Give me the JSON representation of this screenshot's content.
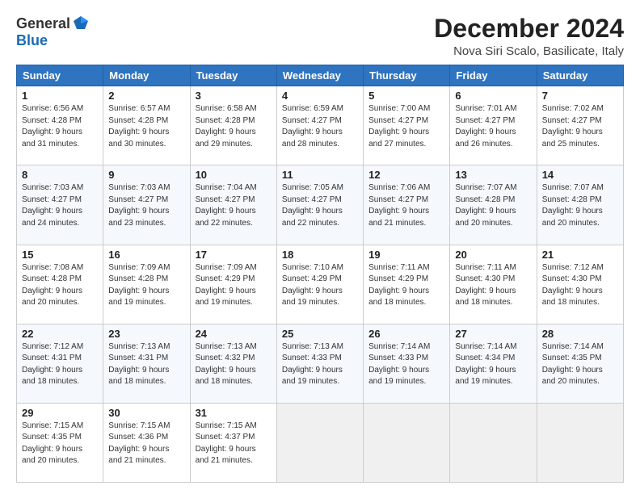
{
  "header": {
    "logo_general": "General",
    "logo_blue": "Blue",
    "month_title": "December 2024",
    "location": "Nova Siri Scalo, Basilicate, Italy"
  },
  "days_of_week": [
    "Sunday",
    "Monday",
    "Tuesday",
    "Wednesday",
    "Thursday",
    "Friday",
    "Saturday"
  ],
  "weeks": [
    [
      {
        "day": "1",
        "info": "Sunrise: 6:56 AM\nSunset: 4:28 PM\nDaylight: 9 hours\nand 31 minutes."
      },
      {
        "day": "2",
        "info": "Sunrise: 6:57 AM\nSunset: 4:28 PM\nDaylight: 9 hours\nand 30 minutes."
      },
      {
        "day": "3",
        "info": "Sunrise: 6:58 AM\nSunset: 4:28 PM\nDaylight: 9 hours\nand 29 minutes."
      },
      {
        "day": "4",
        "info": "Sunrise: 6:59 AM\nSunset: 4:27 PM\nDaylight: 9 hours\nand 28 minutes."
      },
      {
        "day": "5",
        "info": "Sunrise: 7:00 AM\nSunset: 4:27 PM\nDaylight: 9 hours\nand 27 minutes."
      },
      {
        "day": "6",
        "info": "Sunrise: 7:01 AM\nSunset: 4:27 PM\nDaylight: 9 hours\nand 26 minutes."
      },
      {
        "day": "7",
        "info": "Sunrise: 7:02 AM\nSunset: 4:27 PM\nDaylight: 9 hours\nand 25 minutes."
      }
    ],
    [
      {
        "day": "8",
        "info": "Sunrise: 7:03 AM\nSunset: 4:27 PM\nDaylight: 9 hours\nand 24 minutes."
      },
      {
        "day": "9",
        "info": "Sunrise: 7:03 AM\nSunset: 4:27 PM\nDaylight: 9 hours\nand 23 minutes."
      },
      {
        "day": "10",
        "info": "Sunrise: 7:04 AM\nSunset: 4:27 PM\nDaylight: 9 hours\nand 22 minutes."
      },
      {
        "day": "11",
        "info": "Sunrise: 7:05 AM\nSunset: 4:27 PM\nDaylight: 9 hours\nand 22 minutes."
      },
      {
        "day": "12",
        "info": "Sunrise: 7:06 AM\nSunset: 4:27 PM\nDaylight: 9 hours\nand 21 minutes."
      },
      {
        "day": "13",
        "info": "Sunrise: 7:07 AM\nSunset: 4:28 PM\nDaylight: 9 hours\nand 20 minutes."
      },
      {
        "day": "14",
        "info": "Sunrise: 7:07 AM\nSunset: 4:28 PM\nDaylight: 9 hours\nand 20 minutes."
      }
    ],
    [
      {
        "day": "15",
        "info": "Sunrise: 7:08 AM\nSunset: 4:28 PM\nDaylight: 9 hours\nand 20 minutes."
      },
      {
        "day": "16",
        "info": "Sunrise: 7:09 AM\nSunset: 4:28 PM\nDaylight: 9 hours\nand 19 minutes."
      },
      {
        "day": "17",
        "info": "Sunrise: 7:09 AM\nSunset: 4:29 PM\nDaylight: 9 hours\nand 19 minutes."
      },
      {
        "day": "18",
        "info": "Sunrise: 7:10 AM\nSunset: 4:29 PM\nDaylight: 9 hours\nand 19 minutes."
      },
      {
        "day": "19",
        "info": "Sunrise: 7:11 AM\nSunset: 4:29 PM\nDaylight: 9 hours\nand 18 minutes."
      },
      {
        "day": "20",
        "info": "Sunrise: 7:11 AM\nSunset: 4:30 PM\nDaylight: 9 hours\nand 18 minutes."
      },
      {
        "day": "21",
        "info": "Sunrise: 7:12 AM\nSunset: 4:30 PM\nDaylight: 9 hours\nand 18 minutes."
      }
    ],
    [
      {
        "day": "22",
        "info": "Sunrise: 7:12 AM\nSunset: 4:31 PM\nDaylight: 9 hours\nand 18 minutes."
      },
      {
        "day": "23",
        "info": "Sunrise: 7:13 AM\nSunset: 4:31 PM\nDaylight: 9 hours\nand 18 minutes."
      },
      {
        "day": "24",
        "info": "Sunrise: 7:13 AM\nSunset: 4:32 PM\nDaylight: 9 hours\nand 18 minutes."
      },
      {
        "day": "25",
        "info": "Sunrise: 7:13 AM\nSunset: 4:33 PM\nDaylight: 9 hours\nand 19 minutes."
      },
      {
        "day": "26",
        "info": "Sunrise: 7:14 AM\nSunset: 4:33 PM\nDaylight: 9 hours\nand 19 minutes."
      },
      {
        "day": "27",
        "info": "Sunrise: 7:14 AM\nSunset: 4:34 PM\nDaylight: 9 hours\nand 19 minutes."
      },
      {
        "day": "28",
        "info": "Sunrise: 7:14 AM\nSunset: 4:35 PM\nDaylight: 9 hours\nand 20 minutes."
      }
    ],
    [
      {
        "day": "29",
        "info": "Sunrise: 7:15 AM\nSunset: 4:35 PM\nDaylight: 9 hours\nand 20 minutes."
      },
      {
        "day": "30",
        "info": "Sunrise: 7:15 AM\nSunset: 4:36 PM\nDaylight: 9 hours\nand 21 minutes."
      },
      {
        "day": "31",
        "info": "Sunrise: 7:15 AM\nSunset: 4:37 PM\nDaylight: 9 hours\nand 21 minutes."
      },
      {
        "day": "",
        "info": ""
      },
      {
        "day": "",
        "info": ""
      },
      {
        "day": "",
        "info": ""
      },
      {
        "day": "",
        "info": ""
      }
    ]
  ]
}
